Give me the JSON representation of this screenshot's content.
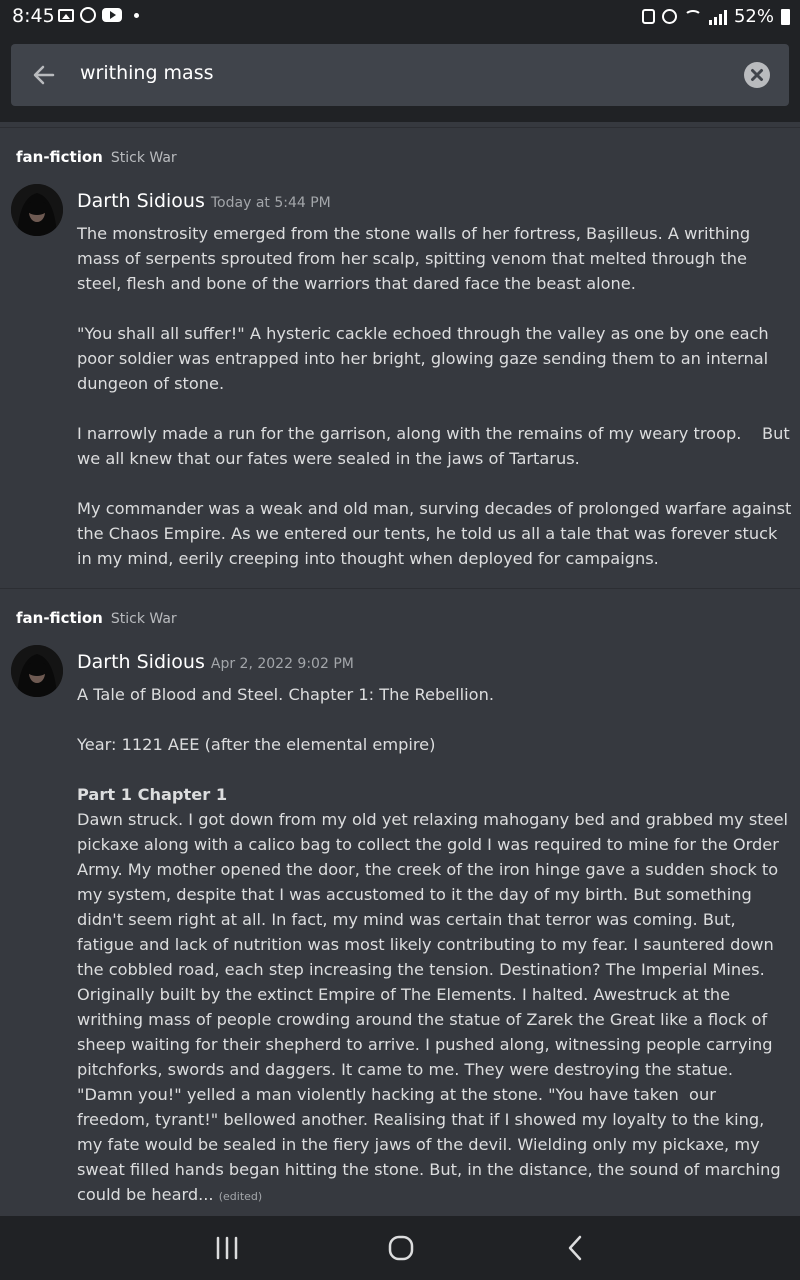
{
  "status_bar": {
    "time": "8:45",
    "battery": "52%",
    "icons_left": [
      "gallery-icon",
      "whatsapp-icon",
      "youtube-icon",
      "dot-icon"
    ],
    "icons_right": [
      "lock-icon",
      "alarm-icon",
      "wifi-icon",
      "signal-icon",
      "battery-icon"
    ]
  },
  "search": {
    "value": "writhing mass"
  },
  "results": [
    {
      "channel": "fan-fiction",
      "category": "Stick War",
      "author": "Darth Sidious",
      "timestamp": "Today at 5:44 PM",
      "paragraphs": [
        "The monstrosity emerged from the stone walls of her fortress, Bașilleus. A writhing mass of serpents sprouted from her scalp, spitting venom that melted through the steel, flesh and bone of the warriors that dared face the beast alone.",
        "\"You shall all suffer!\" A hysteric cackle echoed through the valley as one by one each poor soldier was entrapped into her bright, glowing gaze sending them to an internal dungeon of stone.",
        "I narrowly made a run for the garrison, along with the remains of my weary troop.    But we all knew that our fates were sealed in the jaws of Tartarus.",
        "My commander was a weak and old man, surving decades of prolonged warfare against the Chaos Empire. As we entered our tents, he told us all a tale that was forever stuck in my mind, eerily creeping into thought when deployed for campaigns."
      ]
    },
    {
      "channel": "fan-fiction",
      "category": "Stick War",
      "author": "Darth Sidious",
      "timestamp": "Apr 2, 2022 9:02 PM",
      "title_line": "A Tale of Blood and Steel. Chapter 1: The Rebellion.",
      "year_line": "Year: 1121 AEE (after the elemental empire)",
      "part_heading": "Part 1 Chapter 1",
      "body": "Dawn struck. I got down from my old yet relaxing mahogany bed and grabbed my steel pickaxe along with a calico bag to collect the gold I was required to mine for the Order Army. My mother opened the door, the creek of the iron hinge gave a sudden shock to my system, despite that I was accustomed to it the day of my birth. But something didn't seem right at all. In fact, my mind was certain that terror was coming. But, fatigue and lack of nutrition was most likely contributing to my fear. I sauntered down the cobbled road, each step increasing the tension. Destination? The Imperial Mines. Originally built by the extinct Empire of The Elements. I halted. Awestruck at the writhing mass of people crowding around the statue of Zarek the Great like a flock of sheep waiting for their shepherd to arrive. I pushed along, witnessing people carrying pitchforks, swords and daggers. It came to me. They were destroying the statue. \"Damn you!\" yelled a man violently hacking at the stone. \"You have taken  our freedom, tyrant!\" bellowed another. Realising that if I showed my loyalty to the king, my fate would be sealed in the fiery jaws of the devil. Wielding only my pickaxe, my sweat filled hands began hitting the stone. But, in the distance, the sound of marching could be heard...",
      "edited": "(edited)"
    }
  ],
  "nav_bar": {
    "buttons": [
      "recent-apps",
      "home",
      "back"
    ]
  },
  "colors": {
    "background": "#36393f",
    "header": "#202225",
    "search_box": "#40444b"
  }
}
